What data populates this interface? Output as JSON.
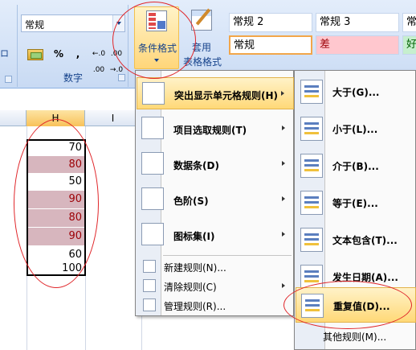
{
  "ribbon": {
    "left_group_fragment": "ロ",
    "number_format": "常规",
    "number_buttons": {
      "currency": "",
      "percent": "%",
      "comma": ",",
      "increase_decimal": "+.0\n.00",
      "decrease_decimal": ".00\n+.0"
    },
    "increase_decimal_label": "←.0 .00",
    "decrease_decimal_label": ".00 →.0",
    "number_group_label": "数字",
    "conditional_format_label": "条件格式",
    "table_format_label_1": "套用",
    "table_format_label_2": "表格格式",
    "styles": {
      "normal2": "常规 2",
      "normal3": "常规 3",
      "good_partial": "常",
      "normal": "常规",
      "bad": "差",
      "good": "好"
    }
  },
  "sheet": {
    "columns": {
      "g": "",
      "h": "H",
      "i": "I"
    },
    "cells": [
      {
        "value": "70",
        "duplicate": false
      },
      {
        "value": "80",
        "duplicate": true
      },
      {
        "value": "50",
        "duplicate": false
      },
      {
        "value": "90",
        "duplicate": true
      },
      {
        "value": "80",
        "duplicate": true
      },
      {
        "value": "90",
        "duplicate": true
      },
      {
        "value": "60",
        "duplicate": false
      },
      {
        "value": "100",
        "duplicate": false
      }
    ]
  },
  "menu_main": {
    "items": [
      {
        "label": "突出显示单元格规则(H)",
        "has_submenu": true
      },
      {
        "label": "项目选取规则(T)",
        "has_submenu": true
      },
      {
        "label": "数据条(D)",
        "has_submenu": true
      },
      {
        "label": "色阶(S)",
        "has_submenu": true
      },
      {
        "label": "图标集(I)",
        "has_submenu": true
      }
    ],
    "small_items": [
      {
        "label": "新建规则(N)...",
        "has_submenu": false
      },
      {
        "label": "清除规则(C)",
        "has_submenu": true
      },
      {
        "label": "管理规则(R)...",
        "has_submenu": false
      }
    ]
  },
  "menu_sub": {
    "items": [
      {
        "label": "大于(G)..."
      },
      {
        "label": "小于(L)..."
      },
      {
        "label": "介于(B)..."
      },
      {
        "label": "等于(E)..."
      },
      {
        "label": "文本包含(T)..."
      },
      {
        "label": "发生日期(A)..."
      },
      {
        "label": "重复值(D)..."
      }
    ],
    "more": "其他规则(M)..."
  },
  "colors": {
    "ribbon_bg": "#d5e3f7",
    "highlight": "#ffd978",
    "duplicate_fill": "#d7b6be",
    "duplicate_text": "#9c0006",
    "annotation_circle": "#e0262a"
  }
}
